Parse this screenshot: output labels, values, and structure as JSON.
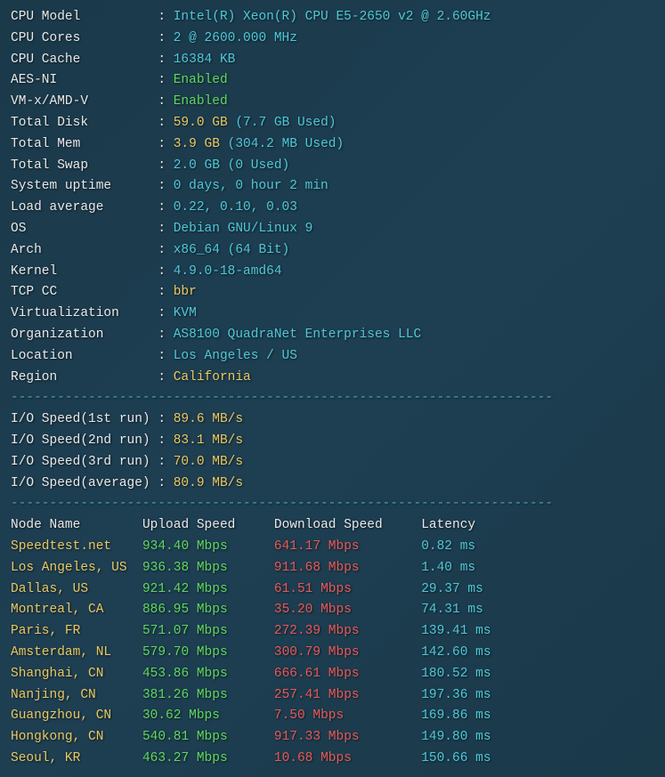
{
  "sys": {
    "cpu_model_label": "CPU Model",
    "cpu_model": "Intel(R) Xeon(R) CPU E5-2650 v2 @ 2.60GHz",
    "cpu_cores_label": "CPU Cores",
    "cpu_cores": "2 @ 2600.000 MHz",
    "cpu_cache_label": "CPU Cache",
    "cpu_cache": "16384 KB",
    "aesni_label": "AES-NI",
    "aesni": "Enabled",
    "vmx_label": "VM-x/AMD-V",
    "vmx": "Enabled",
    "total_disk_label": "Total Disk",
    "total_disk_val": "59.0 GB",
    "total_disk_used": "(7.7 GB Used)",
    "total_mem_label": "Total Mem",
    "total_mem_val": "3.9 GB",
    "total_mem_used": "(304.2 MB Used)",
    "total_swap_label": "Total Swap",
    "total_swap_val": "2.0 GB",
    "total_swap_used": "(0 Used)",
    "uptime_label": "System uptime",
    "uptime": "0 days, 0 hour 2 min",
    "load_label": "Load average",
    "load": "0.22, 0.10, 0.03",
    "os_label": "OS",
    "os": "Debian GNU/Linux 9",
    "arch_label": "Arch",
    "arch_val": "x86_64",
    "arch_bits": "(64 Bit)",
    "kernel_label": "Kernel",
    "kernel": "4.9.0-18-amd64",
    "tcpcc_label": "TCP CC",
    "tcpcc": "bbr",
    "virt_label": "Virtualization",
    "virt": "KVM",
    "org_label": "Organization",
    "org": "AS8100 QuadraNet Enterprises LLC",
    "loc_label": "Location",
    "loc": "Los Angeles / US",
    "region_label": "Region",
    "region": "California"
  },
  "io": {
    "run1_label": "I/O Speed(1st run)",
    "run1": "89.6 MB/s",
    "run2_label": "I/O Speed(2nd run)",
    "run2": "83.1 MB/s",
    "run3_label": "I/O Speed(3rd run)",
    "run3": "70.0 MB/s",
    "avg_label": "I/O Speed(average)",
    "avg": "80.9 MB/s"
  },
  "speed": {
    "headers": {
      "node": "Node Name",
      "up": "Upload Speed",
      "down": "Download Speed",
      "lat": "Latency"
    },
    "rows": [
      {
        "node": "Speedtest.net",
        "up": "934.40 Mbps",
        "down": "641.17 Mbps",
        "lat": "0.82 ms"
      },
      {
        "node": "Los Angeles, US",
        "up": "936.38 Mbps",
        "down": "911.68 Mbps",
        "lat": "1.40 ms"
      },
      {
        "node": "Dallas, US",
        "up": "921.42 Mbps",
        "down": "61.51 Mbps",
        "lat": "29.37 ms"
      },
      {
        "node": "Montreal, CA",
        "up": "886.95 Mbps",
        "down": "35.20 Mbps",
        "lat": "74.31 ms"
      },
      {
        "node": "Paris, FR",
        "up": "571.07 Mbps",
        "down": "272.39 Mbps",
        "lat": "139.41 ms"
      },
      {
        "node": "Amsterdam, NL",
        "up": "579.70 Mbps",
        "down": "300.79 Mbps",
        "lat": "142.60 ms"
      },
      {
        "node": "Shanghai, CN",
        "up": "453.86 Mbps",
        "down": "666.61 Mbps",
        "lat": "180.52 ms"
      },
      {
        "node": "Nanjing, CN",
        "up": "381.26 Mbps",
        "down": "257.41 Mbps",
        "lat": "197.36 ms"
      },
      {
        "node": "Guangzhou, CN",
        "up": "30.62 Mbps",
        "down": "7.50 Mbps",
        "lat": "169.86 ms"
      },
      {
        "node": "Hongkong, CN",
        "up": "540.81 Mbps",
        "down": "917.33 Mbps",
        "lat": "149.80 ms"
      },
      {
        "node": "Seoul, KR",
        "up": "463.27 Mbps",
        "down": "10.68 Mbps",
        "lat": "150.66 ms"
      }
    ]
  },
  "divider": "----------------------------------------------------------------------"
}
